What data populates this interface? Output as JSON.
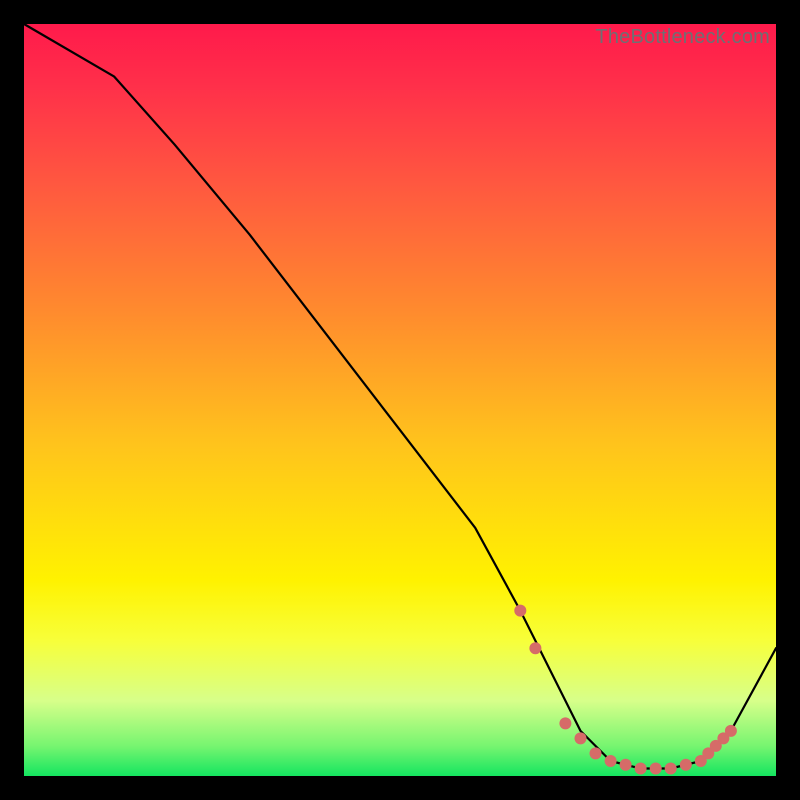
{
  "watermark": "TheBottleneck.com",
  "colors": {
    "page_bg": "#000000",
    "curve": "#000000",
    "dots": "#d66b68"
  },
  "chart_data": {
    "type": "line",
    "title": "",
    "xlabel": "",
    "ylabel": "",
    "xlim": [
      0,
      100
    ],
    "ylim": [
      0,
      100
    ],
    "grid": false,
    "legend": false,
    "series": [
      {
        "name": "bottleneck-curve",
        "x": [
          0,
          12,
          20,
          30,
          40,
          50,
          60,
          66,
          70,
          74,
          78,
          82,
          86,
          90,
          94,
          100
        ],
        "y": [
          100,
          93,
          84,
          72,
          59,
          46,
          33,
          22,
          14,
          6,
          2,
          1,
          1,
          2,
          6,
          17
        ]
      }
    ],
    "marker_points": {
      "name": "highlight-dots",
      "x": [
        66,
        68,
        72,
        74,
        76,
        78,
        80,
        82,
        84,
        86,
        88,
        90,
        91,
        92,
        93,
        94
      ],
      "y": [
        22,
        17,
        7,
        5,
        3,
        2,
        1.5,
        1,
        1,
        1,
        1.5,
        2,
        3,
        4,
        5,
        6
      ]
    }
  }
}
